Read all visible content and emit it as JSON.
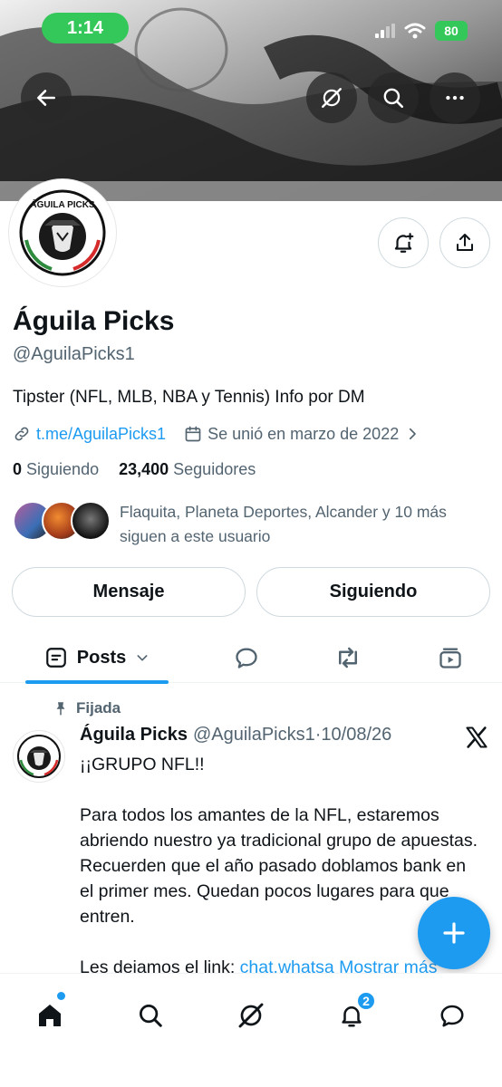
{
  "status_bar": {
    "time": "1:14",
    "battery": "80"
  },
  "colors": {
    "accent": "#1d9bf0",
    "status_green": "#34c759",
    "text_primary": "#0f1419",
    "text_secondary": "#536471"
  },
  "header": {
    "icons": [
      "back-arrow-icon",
      "grok-icon",
      "search-icon",
      "more-icon"
    ]
  },
  "profile": {
    "avatar_text": "ÁGUILA PICKS",
    "name": "Águila Picks",
    "handle": "@AguilaPicks1",
    "bio": "Tipster (NFL, MLB, NBA y Tennis) Info por DM",
    "link": "t.me/AguilaPicks1",
    "joined": "Se unió en marzo de 2022",
    "following_count": "0",
    "following_label": "Siguiendo",
    "followers_count": "23,400",
    "followers_label": "Seguidores",
    "followed_by_line1": "Flaquita, Planeta Deportes, Alcander y 10 más",
    "followed_by_line2": "siguen a este usuario"
  },
  "actions": {
    "message": "Mensaje",
    "following": "Siguiendo"
  },
  "tabs": {
    "posts": "Posts"
  },
  "pinned_post": {
    "pinned_label": "Fijada",
    "author_name": "Águila Picks",
    "author_handle": "@AguilaPicks1",
    "date": "·10/08/26",
    "line1": "¡¡GRUPO NFL!!",
    "paragraph2": "Para todos los amantes de la NFL, estaremos abriendo nuestro ya tradicional grupo de apuestas. Recuerden que el año pasado doblamos bank en el primer mes. Quedan pocos lugares para que entren.",
    "paragraph3_text": "Les dejamos el link: ",
    "paragraph3_link": "chat.whatsa Mostrar más"
  },
  "bottom_nav": {
    "notifications_badge": "2"
  }
}
